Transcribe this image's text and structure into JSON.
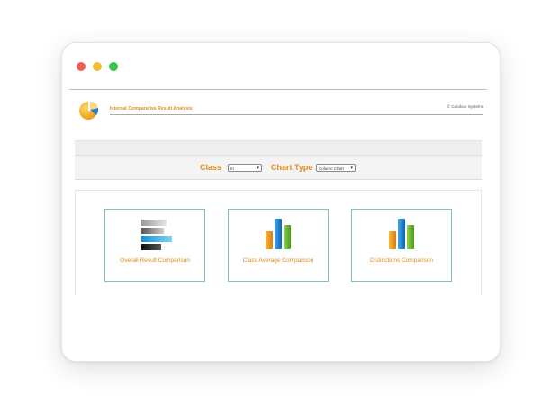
{
  "window": {
    "controls": [
      "close",
      "minimize",
      "maximize"
    ]
  },
  "header": {
    "app_title": "Internal Comparative Result Analysis",
    "copyright": "© Candour Systems",
    "logo_icon": "pie-chart-icon"
  },
  "filters": {
    "class_label": "Class",
    "class_value": "III",
    "chart_type_label": "Chart Type",
    "chart_type_value": "Column Chart"
  },
  "cards": [
    {
      "label": "Overall Result Comparison",
      "icon": "bar-chart-horizontal-icon"
    },
    {
      "label": "Class Average Comparison",
      "icon": "column-chart-icon"
    },
    {
      "label": "Distinctions Comparison",
      "icon": "column-chart-icon"
    }
  ],
  "colors": {
    "accent": "#e28a1a",
    "card_border": "#7fc3b2"
  }
}
